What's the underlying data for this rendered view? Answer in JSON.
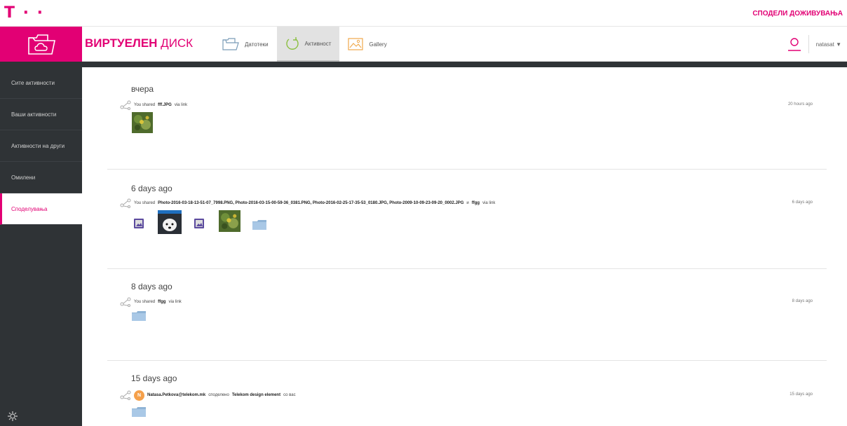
{
  "top": {
    "logo": "T · ·",
    "slogan": "СПОДЕЛИ ДОЖИВУВАЊА"
  },
  "header": {
    "title_bold": "ВИРТУЕЛЕН",
    "title_light": " ДИСК",
    "tabs": [
      {
        "label": "Датотеки",
        "icon": "folder-icon"
      },
      {
        "label": "Активност",
        "icon": "refresh-icon"
      },
      {
        "label": "Gallery",
        "icon": "image-icon"
      }
    ],
    "user": "natasat ▼"
  },
  "sidebar": {
    "items": [
      {
        "label": "Сите активности"
      },
      {
        "label": "Ваши активности"
      },
      {
        "label": "Активности на други"
      },
      {
        "label": "Омилени"
      },
      {
        "label": "Споделувања"
      }
    ]
  },
  "colors": {
    "accent": "#e20074",
    "sidebar": "#2f3336"
  },
  "groups": [
    {
      "title": "вчера",
      "prefix": "You shared ",
      "files": "fff.JPG",
      "suffix": " via link",
      "time": "20 hours ago"
    },
    {
      "title": "6 days ago",
      "prefix": "You shared ",
      "files": "Photo-2016-03-18-13-51-07_7998.PNG, Photo-2016-03-15-00-59-36_0381.PNG, Photo-2016-02-25-17-35-53_0180.JPG, Photo-2009-10-09-23-09-20_0002.JPG",
      "mid": " и ",
      "files2": "ffgg",
      "suffix": " via link",
      "time": "6 days ago"
    },
    {
      "title": "8 days ago",
      "prefix": "You shared ",
      "files": "ffgg",
      "suffix": " via link",
      "time": "8 days ago"
    },
    {
      "title": "15 days ago",
      "avatar": "N",
      "user": "Natasa.Petkova@telekom.mk",
      "mid": " споделено ",
      "files": "Telekom design element",
      "suffix": " со вас",
      "time": "15 days ago"
    }
  ]
}
